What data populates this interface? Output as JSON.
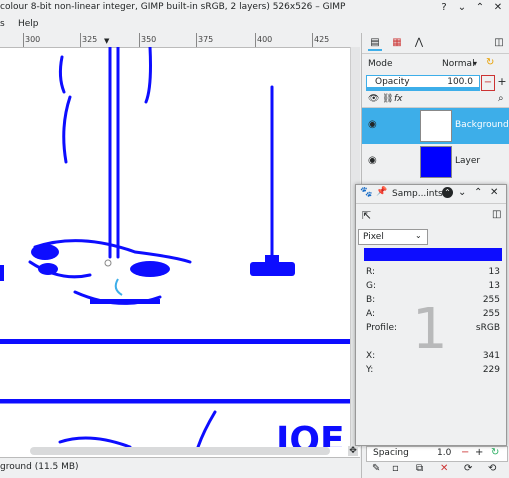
{
  "window": {
    "title": "colour 8-bit non-linear integer, GIMP built-in sRGB, 2 layers) 526x526 – GIMP"
  },
  "menubar": {
    "items": [
      "s",
      "Help"
    ]
  },
  "ruler": {
    "ticks": [
      "300",
      "325",
      "350",
      "375",
      "400",
      "425"
    ]
  },
  "canvas": {
    "text_visible": "JOE"
  },
  "statusbar": {
    "text": "ground (11.5 MB)"
  },
  "layers_panel": {
    "mode_label": "Mode",
    "mode_value": "Normal",
    "opacity_label": "Opacity",
    "opacity_value": "100.0",
    "layers": [
      {
        "name": "Background",
        "selected": true
      },
      {
        "name": "Layer",
        "selected": false
      }
    ],
    "spacing_label": "Spacing",
    "spacing_value": "1.0"
  },
  "sample_points": {
    "title": "Samp...ints",
    "pixel_mode": "Pixel",
    "swatch_color": "#0d0dff",
    "big_number": "1",
    "rows": [
      {
        "label": "R:",
        "value": "13"
      },
      {
        "label": "G:",
        "value": "13"
      },
      {
        "label": "B:",
        "value": "255"
      },
      {
        "label": "A:",
        "value": "255"
      },
      {
        "label": "Profile:",
        "value": "sRGB"
      }
    ],
    "coords": [
      {
        "label": "X:",
        "value": "341"
      },
      {
        "label": "Y:",
        "value": "229"
      }
    ]
  },
  "colors": {
    "accent": "#3daee9",
    "drawing_blue": "#0d0dff",
    "layer_fill": "#0000ff"
  }
}
